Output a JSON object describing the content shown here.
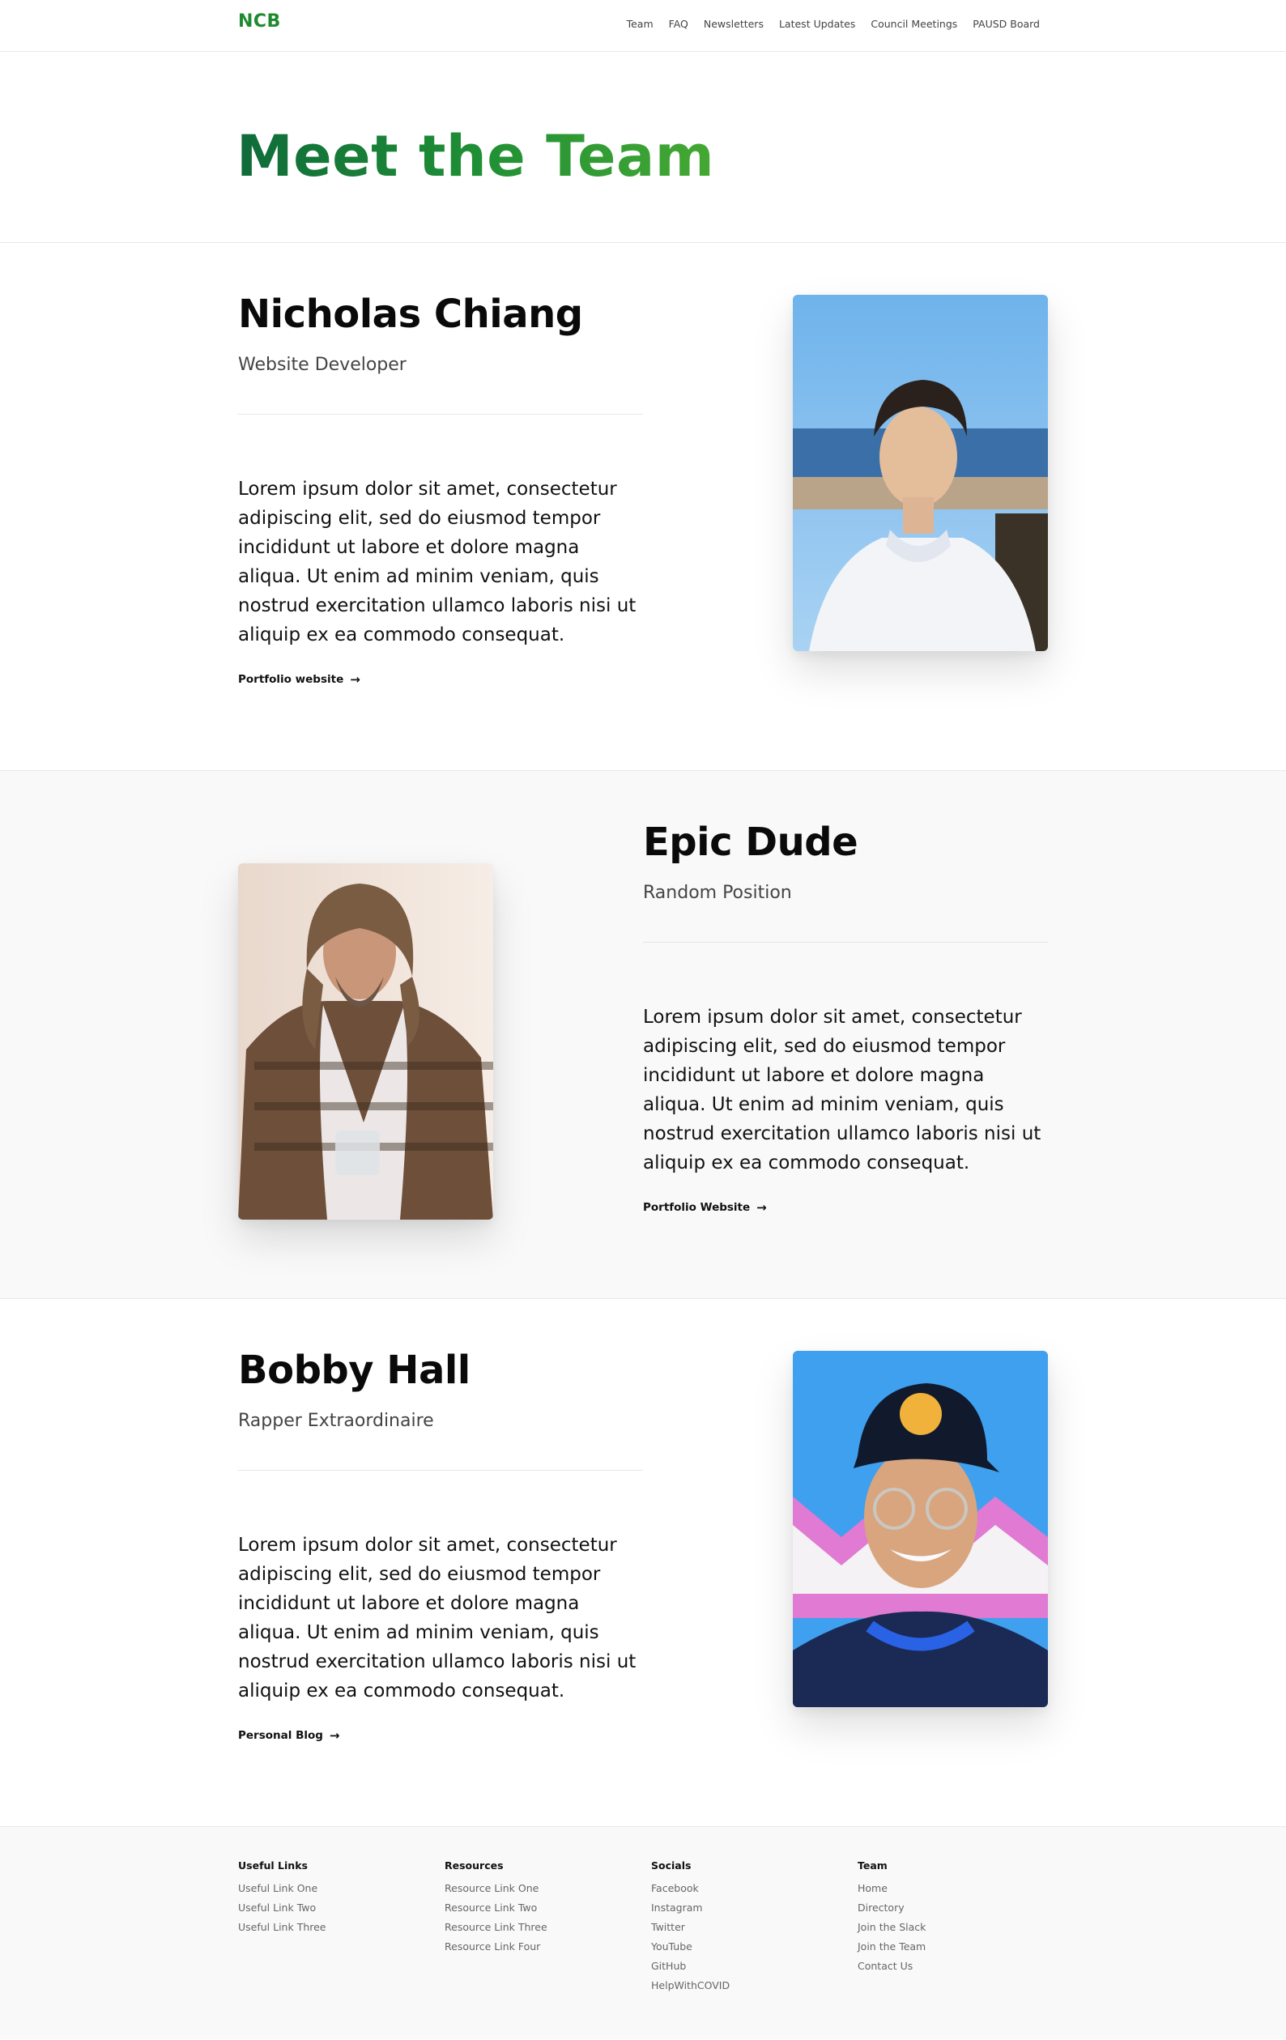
{
  "nav": {
    "logo": "NCB",
    "links": [
      "Team",
      "FAQ",
      "Newsletters",
      "Latest Updates",
      "Council Meetings",
      "PAUSD Board"
    ]
  },
  "hero": {
    "title": "Meet the Team"
  },
  "members": [
    {
      "name": "Nicholas Chiang",
      "role": "Website Developer",
      "bio": "Lorem ipsum dolor sit amet, consectetur adipiscing elit, sed do eiusmod tempor incididunt ut labore et dolore magna aliqua. Ut enim ad minim veniam, quis nostrud exercitation ullamco laboris nisi ut aliquip ex ea commodo consequat.",
      "link": "Portfolio website",
      "arrow": "→"
    },
    {
      "name": "Epic Dude",
      "role": "Random Position",
      "bio": "Lorem ipsum dolor sit amet, consectetur adipiscing elit, sed do eiusmod tempor incididunt ut labore et dolore magna aliqua. Ut enim ad minim veniam, quis nostrud exercitation ullamco laboris nisi ut aliquip ex ea commodo consequat.",
      "link": "Portfolio Website",
      "arrow": "→"
    },
    {
      "name": "Bobby Hall",
      "role": "Rapper Extraordinaire",
      "bio": "Lorem ipsum dolor sit amet, consectetur adipiscing elit, sed do eiusmod tempor incididunt ut labore et dolore magna aliqua. Ut enim ad minim veniam, quis nostrud exercitation ullamco laboris nisi ut aliquip ex ea commodo consequat.",
      "link": "Personal Blog",
      "arrow": "→"
    }
  ],
  "footer": {
    "columns": [
      {
        "title": "Useful Links",
        "links": [
          "Useful Link One",
          "Useful Link Two",
          "Useful Link Three"
        ]
      },
      {
        "title": "Resources",
        "links": [
          "Resource Link One",
          "Resource Link Two",
          "Resource Link Three",
          "Resource Link Four"
        ]
      },
      {
        "title": "Socials",
        "links": [
          "Facebook",
          "Instagram",
          "Twitter",
          "YouTube",
          "GitHub",
          "HelpWithCOVID"
        ]
      },
      {
        "title": "Team",
        "links": [
          "Home",
          "Directory",
          "Join the Slack",
          "Join the Team",
          "Contact Us"
        ]
      }
    ]
  },
  "colors": {
    "brand": "#1e8a2f",
    "gradient_start": "#0f6b3a",
    "gradient_end": "#45a833"
  }
}
